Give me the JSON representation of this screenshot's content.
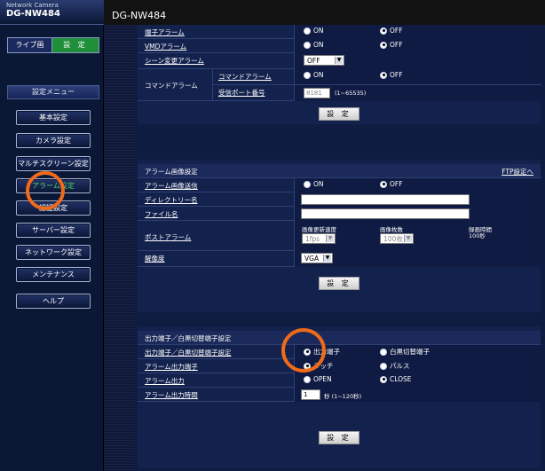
{
  "brand": {
    "sub": "Network Camera",
    "model": "DG-NW484"
  },
  "topbar": {
    "model": "DG-NW484"
  },
  "mode": {
    "live": "ライブ画",
    "setup": "設 定"
  },
  "sidebar": {
    "menu_title": "設定メニュー",
    "items": [
      {
        "label": "基本設定"
      },
      {
        "label": "カメラ設定"
      },
      {
        "label": "マルチスクリーン設定"
      },
      {
        "label": "アラーム設定",
        "active": true
      },
      {
        "label": "認証設定"
      },
      {
        "label": "サーバー設定"
      },
      {
        "label": "ネットワーク設定"
      },
      {
        "label": "メンテナンス"
      },
      {
        "label": "ヘルプ"
      }
    ]
  },
  "alarm": {
    "terminal_alarm": {
      "label": "端子アラーム",
      "on": "ON",
      "off": "OFF"
    },
    "vmd_alarm": {
      "label": "VMDアラーム",
      "on": "ON",
      "off": "OFF"
    },
    "scene_change": {
      "label": "シーン変更アラーム",
      "value": "OFF"
    },
    "command_alarm": {
      "label": "コマンドアラーム",
      "sub_label": "コマンドアラーム",
      "on": "ON",
      "off": "OFF",
      "port_label": "受信ポート番号",
      "port_value": "8181",
      "port_range": "(1~65535)"
    },
    "set_label": "設 定"
  },
  "image": {
    "header": "アラーム画像設定",
    "ftp_link": "FTP設定へ",
    "send": {
      "label": "アラーム画像送信",
      "on": "ON",
      "off": "OFF"
    },
    "directory": {
      "label": "ディレクトリー名",
      "value": ""
    },
    "filename": {
      "label": "ファイル名",
      "value": ""
    },
    "post_alarm": {
      "label": "ポストアラーム",
      "rate_label": "画像更新速度",
      "rate_value": "1fps",
      "count_label": "画像枚数",
      "count_value": "100枚",
      "time_label": "録画時間",
      "time_value": "100秒"
    },
    "resolution": {
      "label": "解像度",
      "value": "VGA"
    },
    "set_label": "設 定"
  },
  "output": {
    "header": "出力端子／白黒切替端子設定",
    "mode": {
      "label": "出力端子／白黒切替端子設定",
      "opt1": "出力端子",
      "opt2": "白黒切替端子"
    },
    "terminal": {
      "label": "アラーム出力端子",
      "opt1": "ラッチ",
      "opt2": "パルス"
    },
    "output": {
      "label": "アラーム出力",
      "opt1": "OPEN",
      "opt2": "CLOSE"
    },
    "time": {
      "label": "アラーム出力時間",
      "value": "1",
      "unit": "秒 (1~120秒)"
    },
    "set_label": "設 定"
  },
  "colors": {
    "accent_green": "#1f8f3a",
    "highlight_ring": "#f06a1a"
  }
}
